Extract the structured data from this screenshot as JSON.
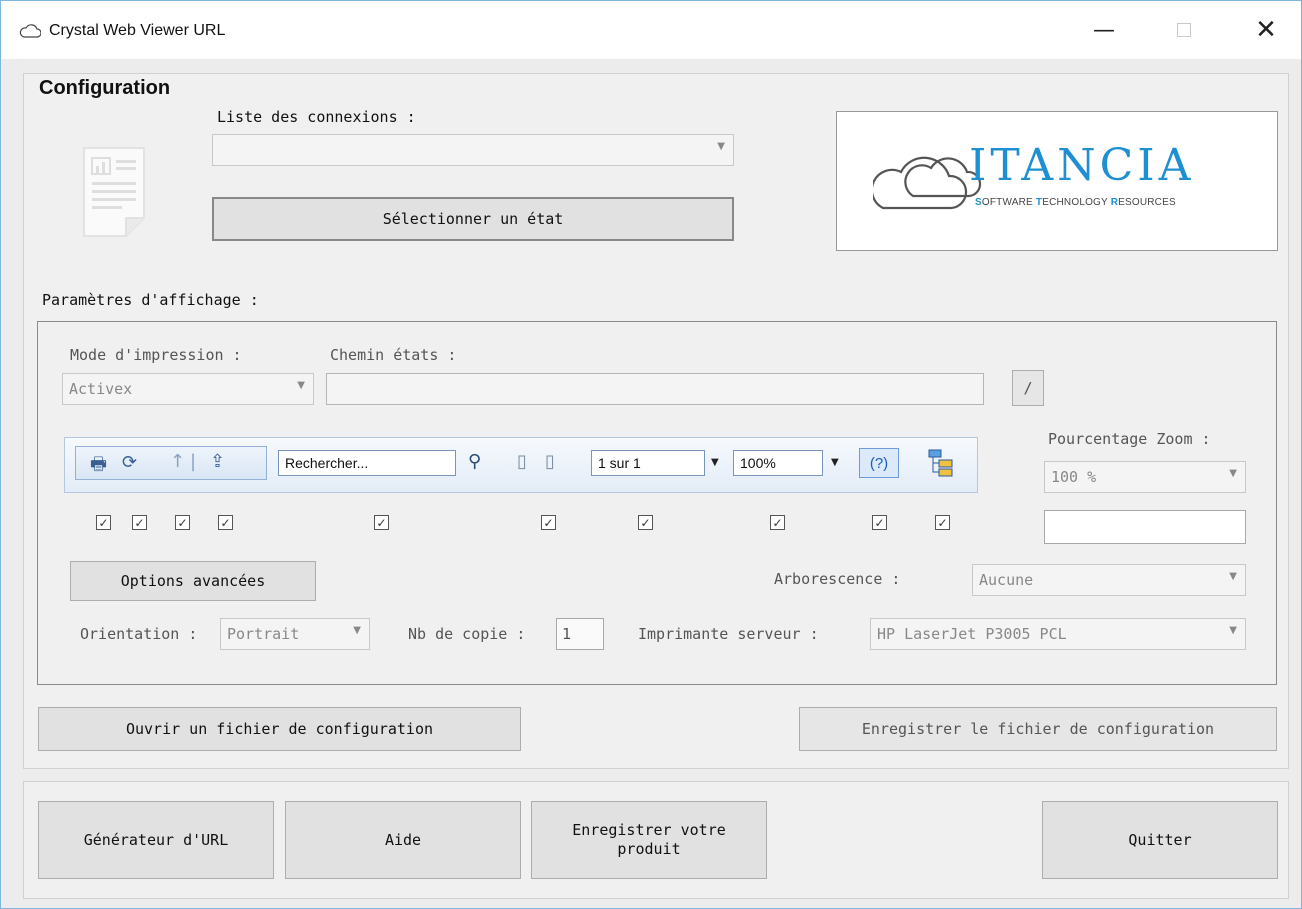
{
  "window": {
    "title": "Crystal Web Viewer URL",
    "minimize_glyph": "—",
    "close_glyph": "✕"
  },
  "config": {
    "section_title": "Configuration",
    "connections_label": "Liste des connexions :",
    "connections_value": "",
    "select_report_button": "Sélectionner un état"
  },
  "logo": {
    "brand": "ITANCIA",
    "tagline_parts": [
      "S",
      "OFTWARE ",
      "T",
      "ECHNOLOGY ",
      "R",
      "ESOURCES"
    ]
  },
  "display": {
    "section_title": "Paramètres d'affichage :",
    "print_mode_label": "Mode d'impression :",
    "print_mode_value": "Activex",
    "reports_path_label": "Chemin états :",
    "reports_path_value": "",
    "browse_button": "/",
    "zoom_label": "Pourcentage Zoom :",
    "zoom_value": "100 %",
    "zoom_extra_value": "",
    "advanced_button": "Options avancées",
    "tree_label": "Arborescence :",
    "tree_value": "Aucune",
    "orientation_label": "Orientation :",
    "orientation_value": "Portrait",
    "copies_label": "Nb de copie :",
    "copies_value": "1",
    "printer_label": "Imprimante serveur :",
    "printer_value": "HP LaserJet P3005 PCL"
  },
  "toolbar_preview": {
    "search_text": "Rechercher...",
    "page_text": "1 sur 1",
    "zoom_text": "100%",
    "help_text": "(?)"
  },
  "checkboxes": {
    "checked_glyph": "✓",
    "states": [
      true,
      true,
      true,
      true,
      true,
      true,
      true,
      true,
      true,
      true
    ]
  },
  "config_file": {
    "open_button": "Ouvrir un fichier de configuration",
    "save_button": "Enregistrer le fichier de configuration"
  },
  "footer": {
    "url_generator_button": "Générateur d'URL",
    "help_button": "Aide",
    "register_button": "Enregistrer votre produit",
    "quit_button": "Quitter"
  },
  "colors": {
    "accent": "#1e8fd0",
    "window_border": "#7fb6de"
  }
}
